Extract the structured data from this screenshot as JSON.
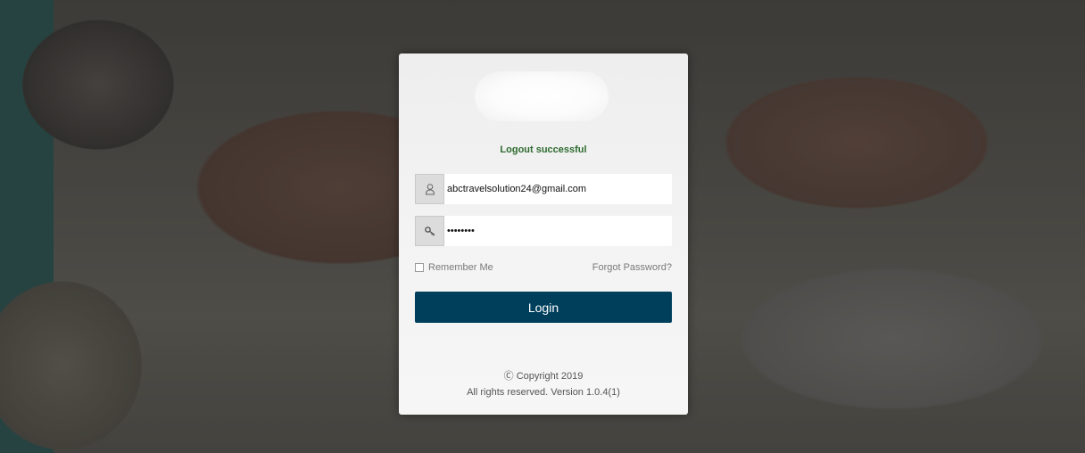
{
  "login": {
    "status_message": "Logout successful",
    "email": {
      "value": "abctravelsolution24@gmail.com",
      "icon": "user-icon"
    },
    "password": {
      "value": "••••••••",
      "icon": "key-icon"
    },
    "remember_label": "Remember Me",
    "remember_checked": false,
    "forgot_label": "Forgot Password?",
    "login_label": "Login",
    "login_color": "#003f5c",
    "status_color": "#2e6b2f"
  },
  "footer": {
    "copyright": "Ⓒ Copyright 2019",
    "rights": "All rights reserved. Version 1.0.4(1)"
  }
}
